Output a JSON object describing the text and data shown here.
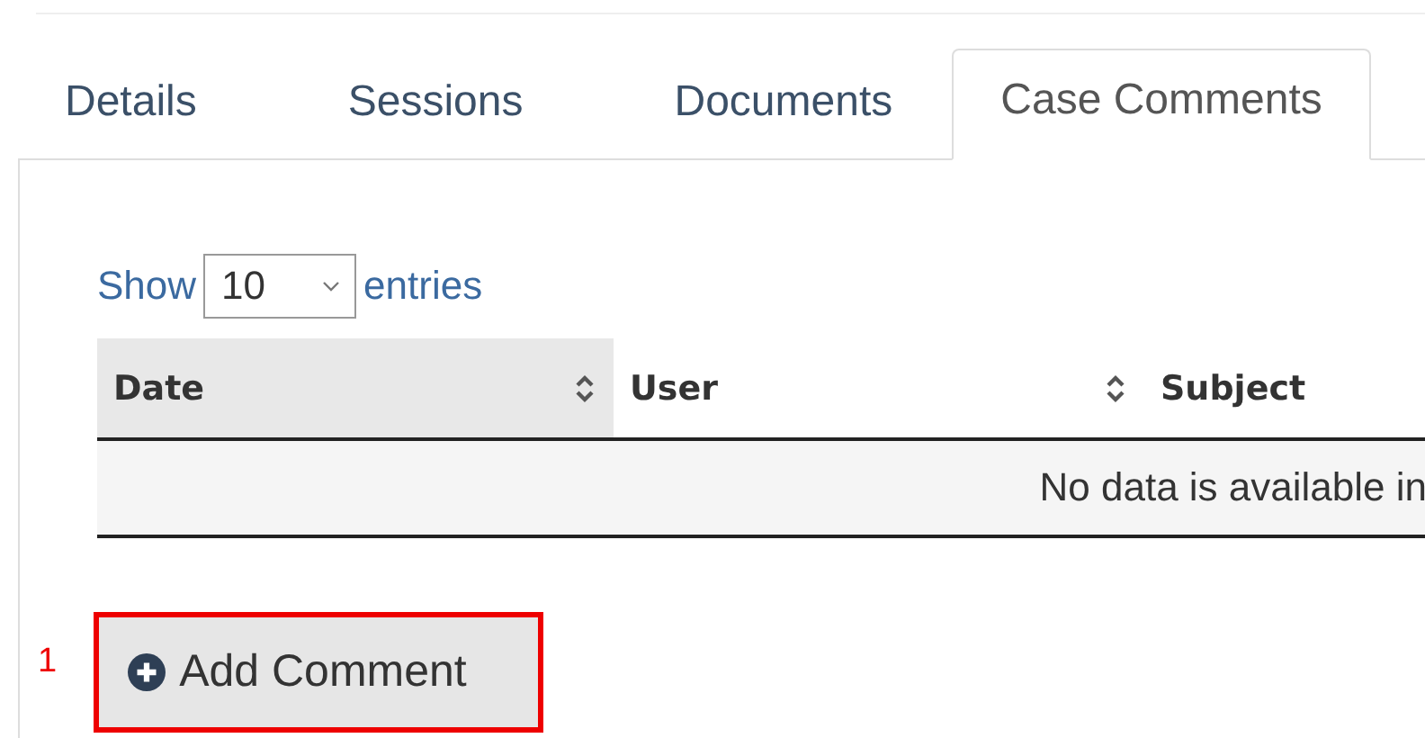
{
  "tabs": [
    {
      "label": "Details",
      "selected": false
    },
    {
      "label": "Sessions",
      "selected": false
    },
    {
      "label": "Documents",
      "selected": false
    },
    {
      "label": "Case Comments",
      "selected": true
    }
  ],
  "length_control": {
    "prefix": "Show",
    "value": "10",
    "suffix": "entries"
  },
  "table": {
    "columns": [
      {
        "label": "Date",
        "sorted": true,
        "sort_icon": true
      },
      {
        "label": "User",
        "sorted": false,
        "sort_icon": true
      },
      {
        "label": "Subject",
        "sorted": false,
        "sort_icon": false
      }
    ],
    "empty_message": "No data is available in"
  },
  "add_button": {
    "label": "Add Comment",
    "highlighted": true,
    "callout": "1"
  }
}
